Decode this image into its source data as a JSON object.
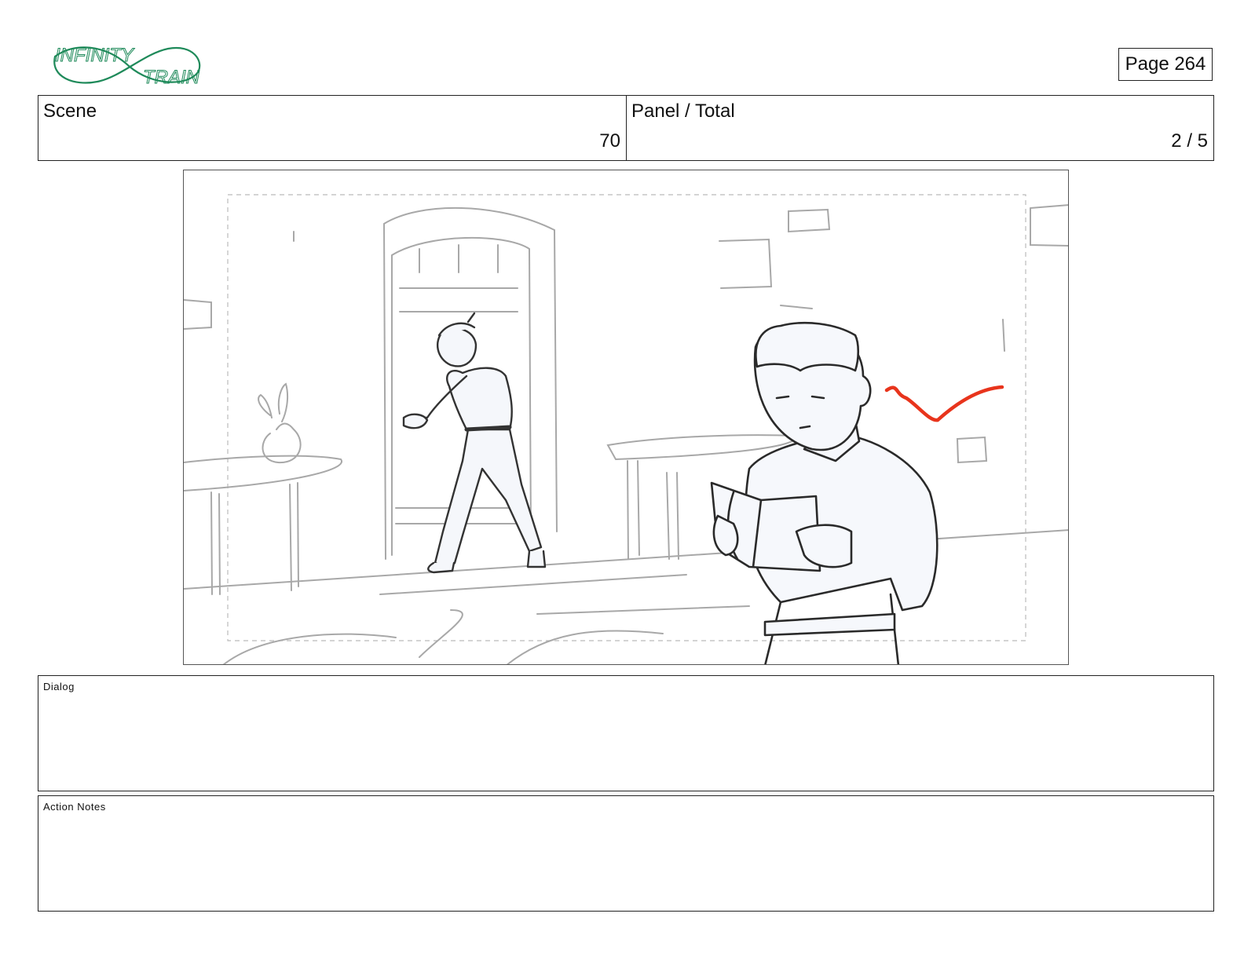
{
  "logo": {
    "line1": "INFINITY",
    "line2": "TRAIN",
    "color": "#1f8a5a"
  },
  "page": {
    "label": "Page 264"
  },
  "header": {
    "scene_label": "Scene",
    "scene_value": "70",
    "panel_label": "Panel / Total",
    "panel_value": "2 / 5"
  },
  "panel_image": {
    "description_icon": "storyboard-sketch",
    "accent_stroke_color": "#e8341c"
  },
  "dialog": {
    "label": "Dialog",
    "text": ""
  },
  "action_notes": {
    "label": "Action Notes",
    "text": ""
  }
}
